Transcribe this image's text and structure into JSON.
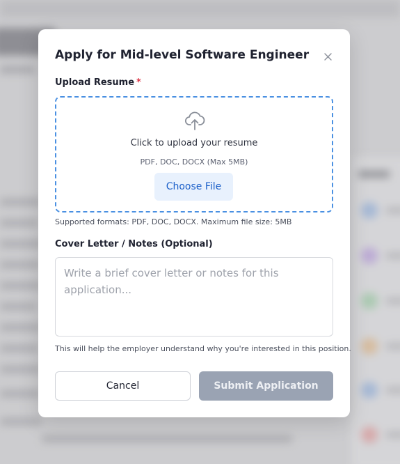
{
  "modal": {
    "title": "Apply for Mid-level Software Engineer",
    "close_icon": "close-icon"
  },
  "resume": {
    "label": "Upload Resume",
    "required_marker": "*",
    "required_color": "#dc3545",
    "dropzone": {
      "icon": "cloud-upload-icon",
      "primary_text": "Click to upload your resume",
      "formats_text": "PDF, DOC, DOCX (Max 5MB)",
      "choose_button_label": "Choose File",
      "border_color": "#4a90e2"
    },
    "supported_note": "Supported formats: PDF, DOC, DOCX. Maximum file size: 5MB"
  },
  "cover_letter": {
    "label": "Cover Letter / Notes (Optional)",
    "placeholder": "Write a brief cover letter or notes for this application...",
    "value": "",
    "hint": "This will help the employer understand why you're interested in this position."
  },
  "actions": {
    "cancel_label": "Cancel",
    "submit_label": "Submit Application",
    "submit_disabled": true
  },
  "colors": {
    "accent": "#1a5fc9",
    "submit_disabled_bg": "#9aa3b3"
  }
}
